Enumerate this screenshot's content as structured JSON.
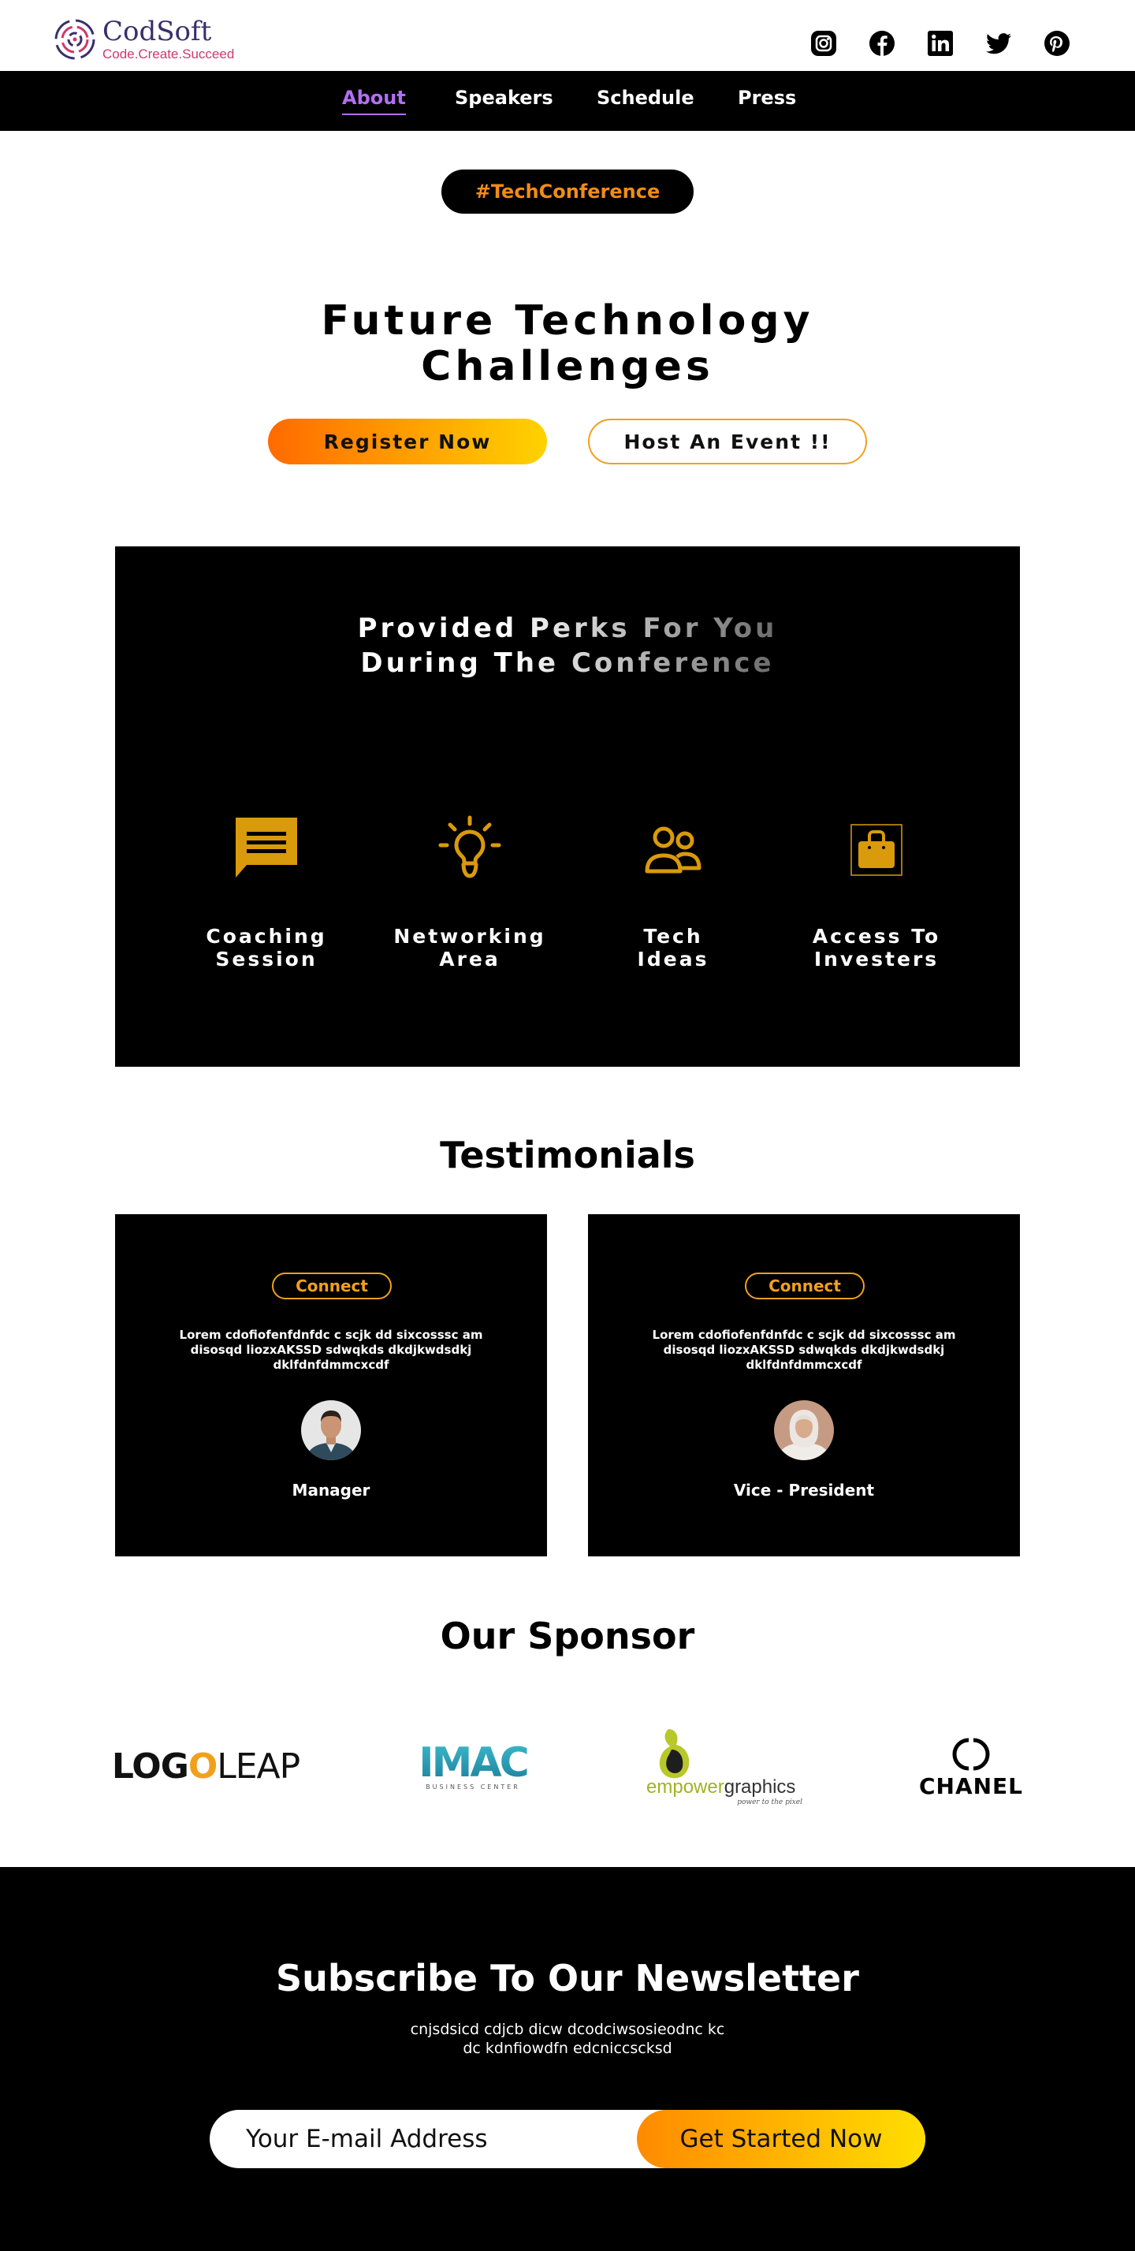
{
  "header": {
    "brand_name": "CodSoft",
    "brand_tagline": "Code.Create.Succeed",
    "social": [
      "instagram-icon",
      "facebook-icon",
      "linkedin-icon",
      "twitter-icon",
      "pinterest-icon"
    ]
  },
  "nav": {
    "items": [
      {
        "label": "About",
        "active": true
      },
      {
        "label": "Speakers",
        "active": false
      },
      {
        "label": "Schedule",
        "active": false
      },
      {
        "label": "Press",
        "active": false
      }
    ]
  },
  "hero": {
    "tag": "#TechConference",
    "title_line1": "Future Technology",
    "title_line2": "Challenges",
    "register_label": "Register Now",
    "host_label": "Host An Event !!"
  },
  "perks": {
    "title_line1": "Provided Perks For You",
    "title_line2": "During The Conference",
    "items": [
      {
        "icon": "chat-icon",
        "line1": "Coaching",
        "line2": "Session"
      },
      {
        "icon": "lightbulb-icon",
        "line1": "Networking",
        "line2": "Area"
      },
      {
        "icon": "people-icon",
        "line1": "Tech",
        "line2": "Ideas"
      },
      {
        "icon": "bag-icon",
        "line1": "Access To",
        "line2": "Investers"
      }
    ]
  },
  "testimonials": {
    "title": "Testimonials",
    "cards": [
      {
        "connect_label": "Connect",
        "quote": "Lorem cdofiofenfdnfdc c scjk dd sixcosssc am disosqd liozxAKSSD sdwqkds dkdjkwdsdkj dklfdnfdmmcxcdf",
        "role": "Manager"
      },
      {
        "connect_label": "Connect",
        "quote": "Lorem cdofiofenfdnfdc c scjk dd sixcosssc am disosqd liozxAKSSD sdwqkds dkdjkwdsdkj dklfdnfdmmcxcdf",
        "role": "Vice - President"
      }
    ]
  },
  "sponsors": {
    "title": "Our Sponsor",
    "logos": [
      {
        "name": "logo-leap-logo",
        "text_a": "LOG",
        "text_b": "O",
        "text_c": "LEAP"
      },
      {
        "name": "imac-logo",
        "text_a": "IMAC",
        "text_b": "BUSINESS CENTER"
      },
      {
        "name": "empowergraphics-logo",
        "text_a": "empower",
        "text_b": "graphics",
        "text_c": "power to the pixel"
      },
      {
        "name": "chanel-logo",
        "text_a": "CHANEL"
      }
    ]
  },
  "newsletter": {
    "title": "Subscribe To Our Newsletter",
    "text_line1": "cnjsdsicd cdjcb dicw dcodciwsosieodnc kc",
    "text_line2": "dc kdnfiowdfn edcniccscksd",
    "email_placeholder": "Your E-mail Address",
    "button_label": "Get Started Now"
  },
  "colors": {
    "accent_orange": "#f0a020",
    "nav_active": "#b46ef5",
    "perk_icon": "#d99a0c"
  }
}
